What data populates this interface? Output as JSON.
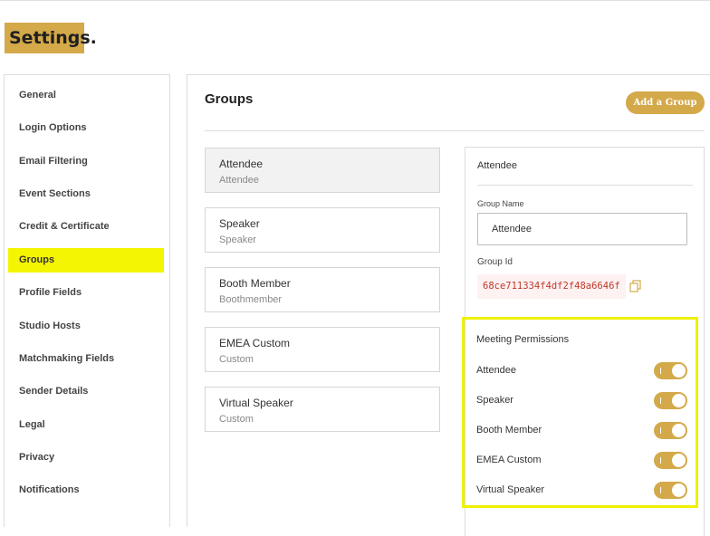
{
  "page": {
    "title": "Settings."
  },
  "sidebar": {
    "items": [
      {
        "label": "General"
      },
      {
        "label": "Login Options"
      },
      {
        "label": "Email Filtering"
      },
      {
        "label": "Event Sections"
      },
      {
        "label": "Credit & Certificate"
      },
      {
        "label": "Groups",
        "active": true
      },
      {
        "label": "Profile Fields"
      },
      {
        "label": "Studio Hosts"
      },
      {
        "label": "Matchmaking Fields"
      },
      {
        "label": "Sender Details"
      },
      {
        "label": "Legal"
      },
      {
        "label": "Privacy"
      },
      {
        "label": "Notifications"
      }
    ]
  },
  "main": {
    "title": "Groups",
    "add_button": "Add a Group",
    "groups": [
      {
        "name": "Attendee",
        "type": "Attendee",
        "selected": true
      },
      {
        "name": "Speaker",
        "type": "Speaker"
      },
      {
        "name": "Booth Member",
        "type": "Boothmember"
      },
      {
        "name": "EMEA Custom",
        "type": "Custom"
      },
      {
        "name": "Virtual Speaker",
        "type": "Custom"
      }
    ]
  },
  "detail": {
    "title": "Attendee",
    "group_name_label": "Group Name",
    "group_name_value": "Attendee",
    "group_id_label": "Group Id",
    "group_id_value": "68ce711334f4df2f48a6646f"
  },
  "permissions": {
    "title": "Meeting Permissions",
    "items": [
      {
        "label": "Attendee",
        "enabled": true
      },
      {
        "label": "Speaker",
        "enabled": true
      },
      {
        "label": "Booth Member",
        "enabled": true
      },
      {
        "label": "EMEA Custom",
        "enabled": true
      },
      {
        "label": "Virtual Speaker",
        "enabled": true
      }
    ]
  },
  "colors": {
    "accent": "#d4a94a",
    "highlight": "#f4f500",
    "id_text": "#c0392b"
  }
}
